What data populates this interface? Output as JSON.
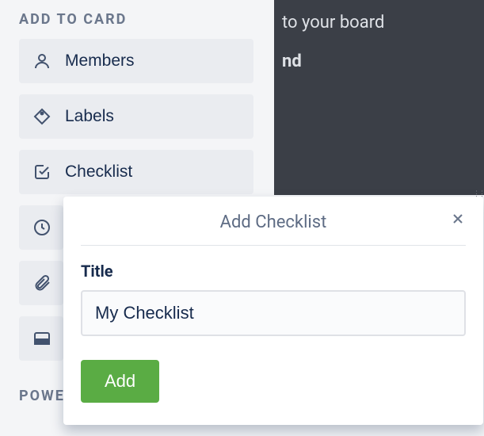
{
  "sidebar": {
    "section_title": "ADD TO CARD",
    "items": [
      {
        "label": "Members",
        "icon": "user-icon"
      },
      {
        "label": "Labels",
        "icon": "tag-icon"
      },
      {
        "label": "Checklist",
        "icon": "checkbox-icon"
      },
      {
        "label": "",
        "icon": "clock-icon"
      },
      {
        "label": "",
        "icon": "attachment-icon"
      },
      {
        "label": "",
        "icon": "cover-icon"
      }
    ],
    "section2_title": "POWE"
  },
  "main": {
    "text_fragment": "to your board",
    "bold_fragment": "nd"
  },
  "popover": {
    "title": "Add Checklist",
    "field_label": "Title",
    "input_value": "My Checklist",
    "submit_label": "Add"
  }
}
